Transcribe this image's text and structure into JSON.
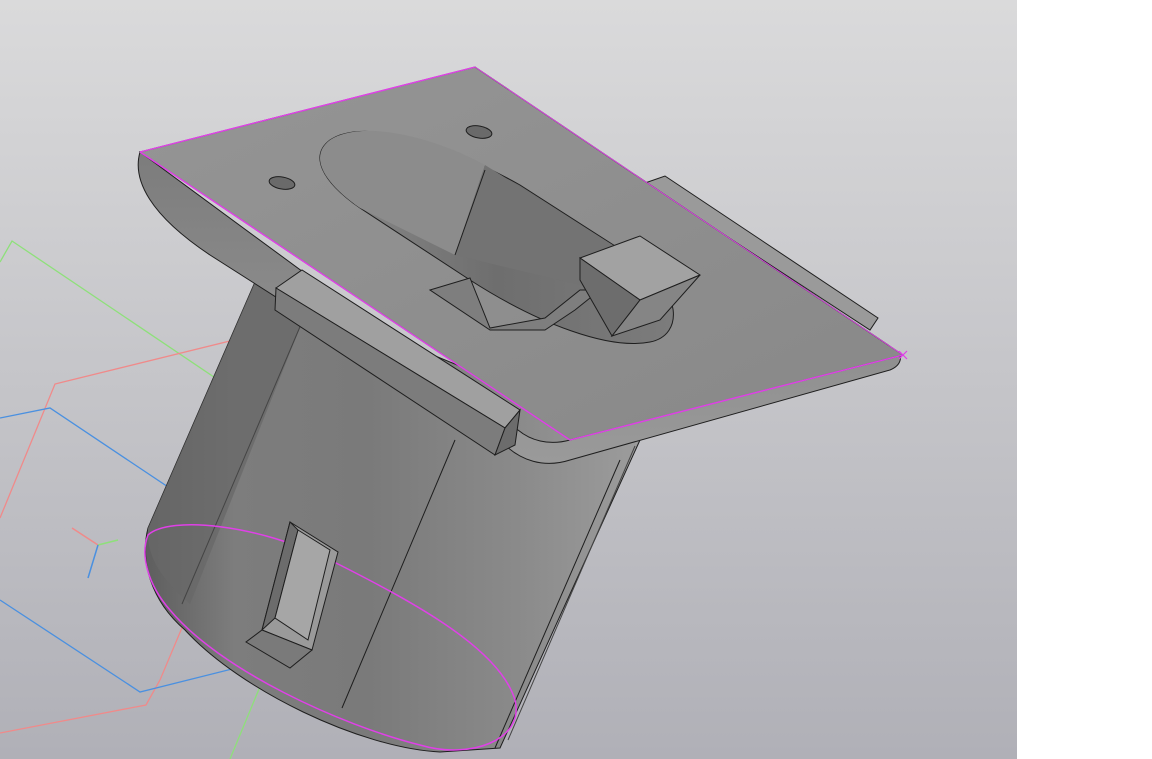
{
  "viewport": {
    "background_top_color": "#d9d9da",
    "background_bottom_color": "#b2b2b8",
    "body_color": "#8e8e8e",
    "edge_color": "#1e1e1e",
    "selection_color": "#e040e8",
    "plane_colors": {
      "red_plane": "#f08a8a",
      "green_plane": "#8ee07a",
      "blue_plane": "#4a90e0"
    },
    "triad_icon": "coordinate-axes-icon"
  },
  "side_panel": {
    "color": "#ffffff"
  }
}
